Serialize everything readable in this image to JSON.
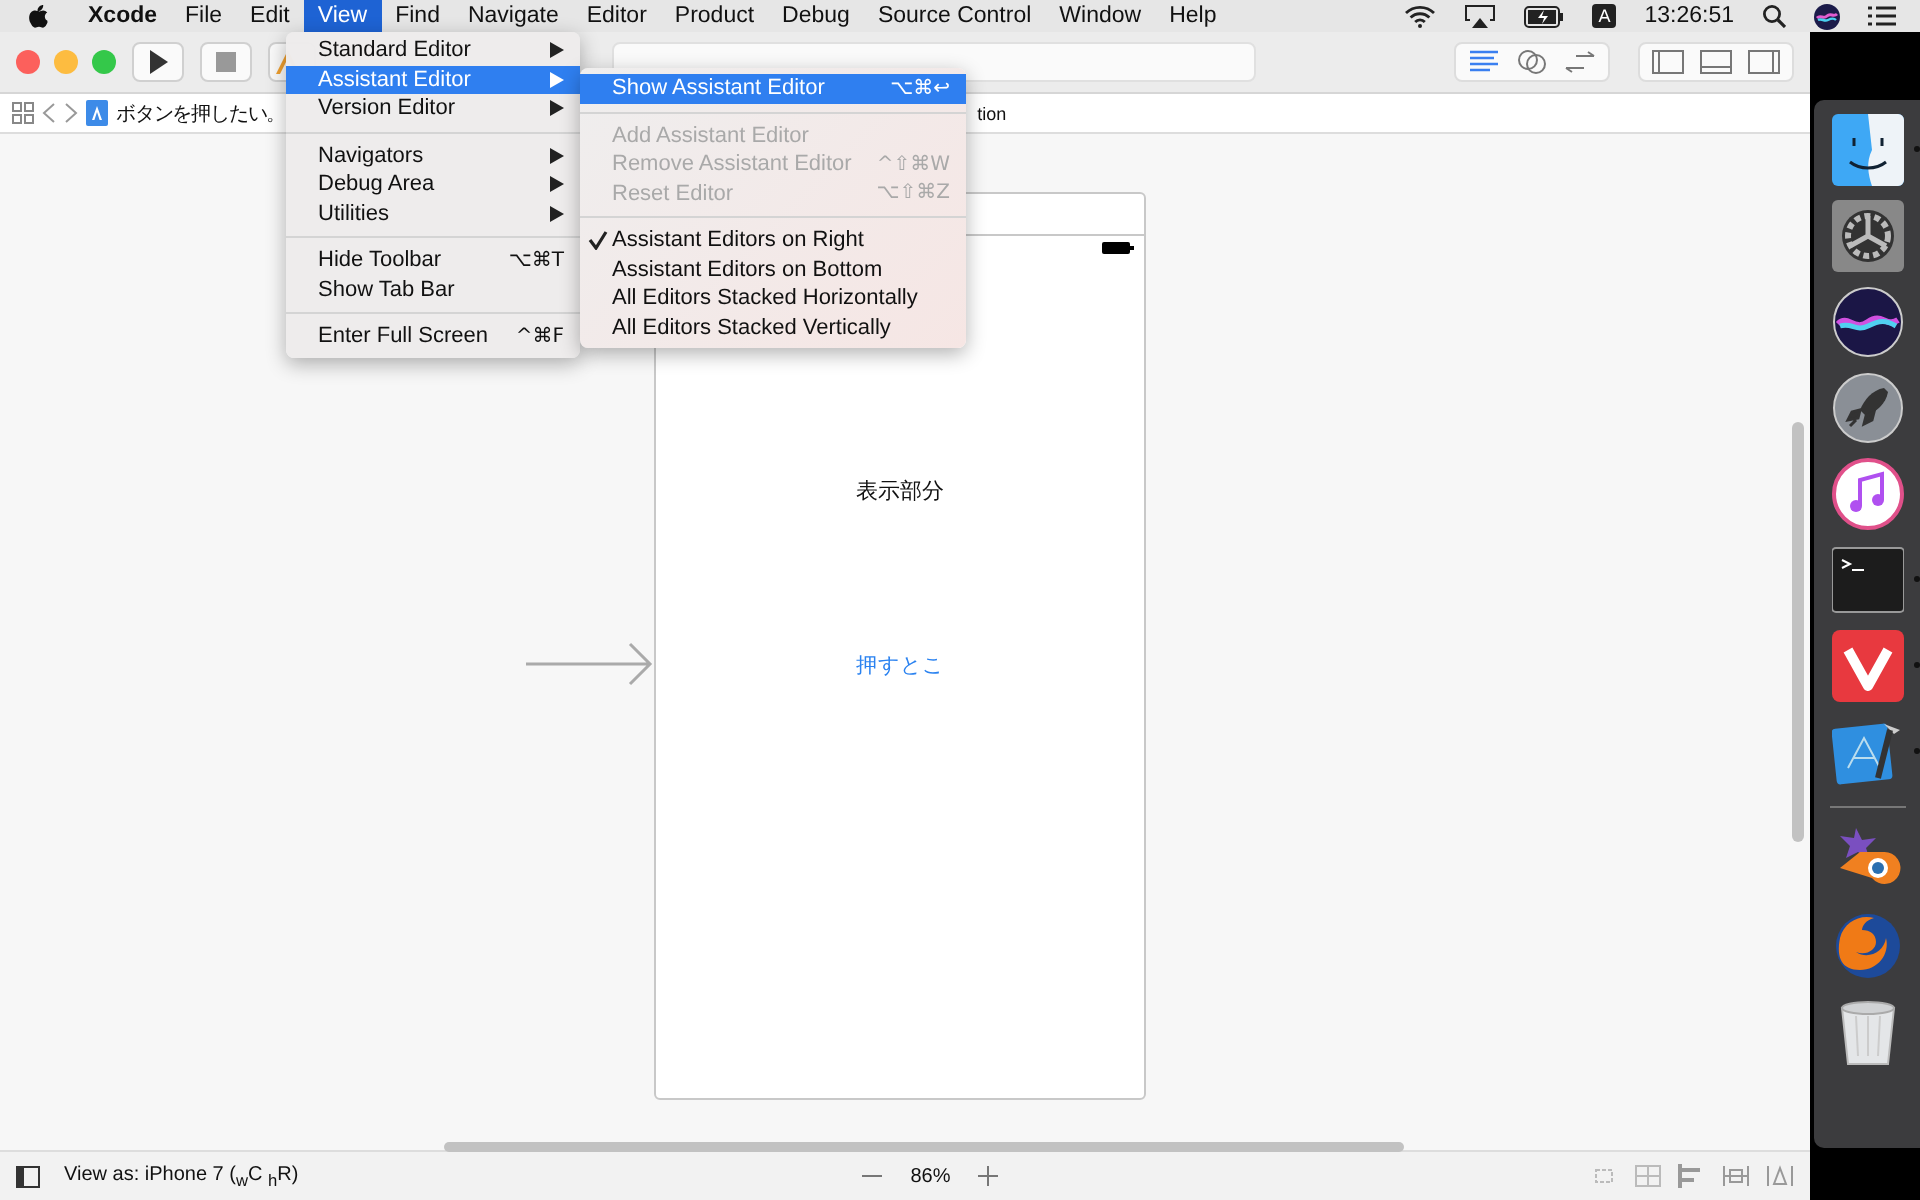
{
  "menubar": {
    "items": [
      {
        "label": "Xcode",
        "selected": false
      },
      {
        "label": "File",
        "selected": false
      },
      {
        "label": "Edit",
        "selected": false
      },
      {
        "label": "View",
        "selected": true
      },
      {
        "label": "Find",
        "selected": false
      },
      {
        "label": "Navigate",
        "selected": false
      },
      {
        "label": "Editor",
        "selected": false
      },
      {
        "label": "Product",
        "selected": false
      },
      {
        "label": "Debug",
        "selected": false
      },
      {
        "label": "Source Control",
        "selected": false
      },
      {
        "label": "Window",
        "selected": false
      },
      {
        "label": "Help",
        "selected": false
      }
    ],
    "input_badge": "A",
    "clock": "13:26:51"
  },
  "breadcrumb": {
    "project": "ボタンを押したい。",
    "tail": "tion"
  },
  "view_menu": {
    "sections": [
      [
        {
          "label": "Standard Editor",
          "submenu": true,
          "highlighted": false
        },
        {
          "label": "Assistant Editor",
          "submenu": true,
          "highlighted": true
        },
        {
          "label": "Version Editor",
          "submenu": true,
          "highlighted": false
        }
      ],
      [
        {
          "label": "Navigators",
          "submenu": true,
          "highlighted": false
        },
        {
          "label": "Debug Area",
          "submenu": true,
          "highlighted": false
        },
        {
          "label": "Utilities",
          "submenu": true,
          "highlighted": false
        }
      ],
      [
        {
          "label": "Hide Toolbar",
          "shortcut": "⌥⌘T",
          "submenu": false,
          "highlighted": false
        },
        {
          "label": "Show Tab Bar",
          "submenu": false,
          "highlighted": false
        }
      ],
      [
        {
          "label": "Enter Full Screen",
          "shortcut": "^⌘F",
          "submenu": false,
          "highlighted": false
        }
      ]
    ]
  },
  "assistant_menu": {
    "sections": [
      [
        {
          "label": "Show Assistant Editor",
          "shortcut": "⌥⌘↩",
          "highlighted": true,
          "disabled": false,
          "checked": false
        }
      ],
      [
        {
          "label": "Add Assistant Editor",
          "highlighted": false,
          "disabled": true,
          "checked": false
        },
        {
          "label": "Remove Assistant Editor",
          "shortcut": "^⇧⌘W",
          "highlighted": false,
          "disabled": true,
          "checked": false
        },
        {
          "label": "Reset Editor",
          "shortcut": "⌥⇧⌘Z",
          "highlighted": false,
          "disabled": true,
          "checked": false
        }
      ],
      [
        {
          "label": "Assistant Editors on Right",
          "highlighted": false,
          "disabled": false,
          "checked": true
        },
        {
          "label": "Assistant Editors on Bottom",
          "highlighted": false,
          "disabled": false,
          "checked": false
        },
        {
          "label": "All Editors Stacked Horizontally",
          "highlighted": false,
          "disabled": false,
          "checked": false
        },
        {
          "label": "All Editors Stacked Vertically",
          "highlighted": false,
          "disabled": false,
          "checked": false
        }
      ]
    ]
  },
  "canvas": {
    "label": "表示部分",
    "button": "押すとこ"
  },
  "bottom_bar": {
    "view_as": "View as: iPhone 7 ($_{w}$C $_{h}$R)",
    "zoom": "86%"
  },
  "dock": [
    {
      "kind": "finder",
      "running": true
    },
    {
      "kind": "settings",
      "running": false
    },
    {
      "kind": "siri",
      "running": false
    },
    {
      "kind": "launchpad",
      "running": false
    },
    {
      "kind": "music",
      "running": false
    },
    {
      "kind": "terminal",
      "running": true
    },
    {
      "kind": "vivaldi",
      "running": true
    },
    {
      "kind": "xcode",
      "running": true
    },
    {
      "kind": "separator",
      "running": false
    },
    {
      "kind": "blender",
      "running": false
    },
    {
      "kind": "firefox",
      "running": false
    },
    {
      "kind": "trash",
      "running": false
    }
  ]
}
